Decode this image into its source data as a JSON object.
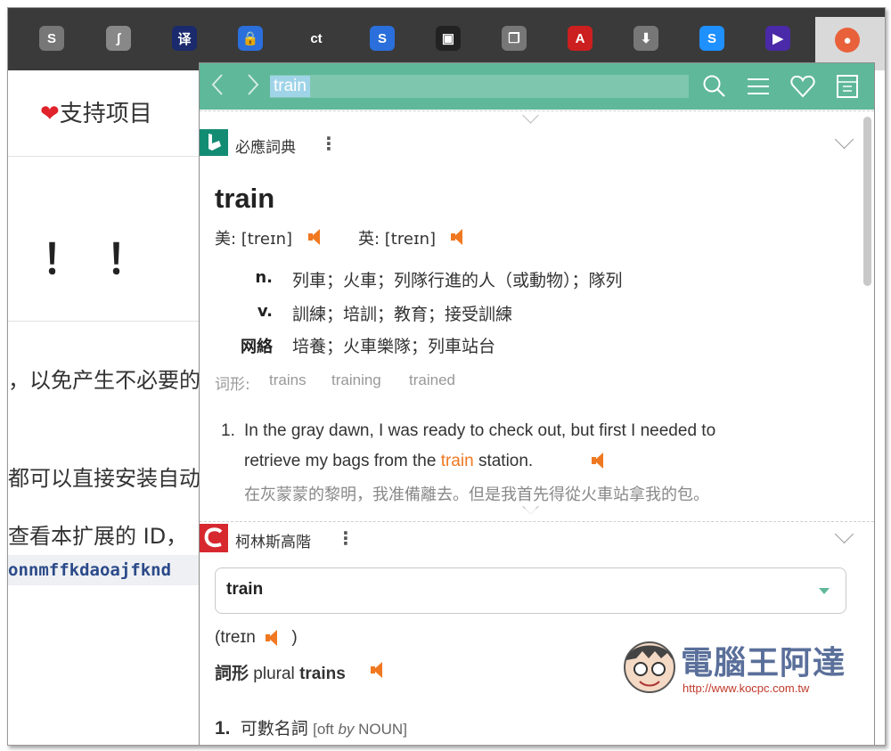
{
  "toolbar": {
    "icons": [
      {
        "name": "simplenote-extension-icon",
        "glyph": "S",
        "color": "#777777"
      },
      {
        "name": "scribe-extension-icon",
        "glyph": "ʃ",
        "color": "#888888"
      },
      {
        "name": "translate-extension-icon",
        "glyph": "译",
        "color": "#1a2a6c"
      },
      {
        "name": "password-lock-extension-icon",
        "glyph": "🔒",
        "color": "#2a6fdb"
      },
      {
        "name": "ct-extension-icon",
        "glyph": "ct",
        "color": "#3a3a3a"
      },
      {
        "name": "s-extension-icon",
        "glyph": "S",
        "color": "#2a6fdb"
      },
      {
        "name": "image-extension-icon",
        "glyph": "▣",
        "color": "#222222"
      },
      {
        "name": "copy-extension-icon",
        "glyph": "❐",
        "color": "#777777"
      },
      {
        "name": "pdf-extension-icon",
        "glyph": "A",
        "color": "#cc1f1f"
      },
      {
        "name": "download-extension-icon",
        "glyph": "⬇",
        "color": "#777777"
      },
      {
        "name": "shazam-extension-icon",
        "glyph": "S",
        "color": "#1e90ff"
      },
      {
        "name": "play-extension-icon",
        "glyph": "▶",
        "color": "#4a2aa8"
      },
      {
        "name": "saladict-extension-icon",
        "glyph": "●",
        "color": "#e8613a"
      }
    ]
  },
  "background": {
    "support": "支持项目",
    "heart": "❤",
    "exclaim": "！！",
    "line1": "，以免产生不必要的",
    "line2": "都可以直接安装自动",
    "line3": "查看本扩展的 ID，",
    "code": "onnmffkdaoajfknd"
  },
  "popup": {
    "search_value": "train",
    "bing": {
      "name": "必應詞典",
      "word": "train",
      "us_label": "美: [treɪn]",
      "uk_label": "英: [treɪn]",
      "defs": [
        {
          "pos": "n.",
          "text": "列車；火車；列隊行進的人（或動物）；隊列"
        },
        {
          "pos": "v.",
          "text": "訓練；培訓；教育；接受訓練"
        },
        {
          "pos": "网絡",
          "text": "培養；火車樂隊；列車站台"
        }
      ],
      "forms_label": "词形:",
      "forms": [
        "trains",
        "training",
        "trained"
      ],
      "example": {
        "num": "1.",
        "en_line1": "In the gray dawn, I was ready to check out, but first I needed to",
        "en_pre": "retrieve my bags from the ",
        "en_hl": "train",
        "en_post": " station.",
        "zh": "在灰蒙蒙的黎明，我准備離去。但是我首先得從火車站拿我的包。"
      }
    },
    "collins": {
      "name": "柯林斯高階",
      "select_value": "train",
      "pron": "(treɪn",
      "pron_close": ")",
      "forms_label": "詞形",
      "forms_plural": "plural",
      "forms_word": "trains",
      "sense_num": "1.",
      "sense_text": "可數名詞",
      "sense_tag_pre": "[oft ",
      "sense_tag_em": "by",
      "sense_tag_post": " NOUN]"
    }
  },
  "watermark": {
    "brand": "電腦王阿達",
    "url": "http://www.kocpc.com.tw"
  }
}
